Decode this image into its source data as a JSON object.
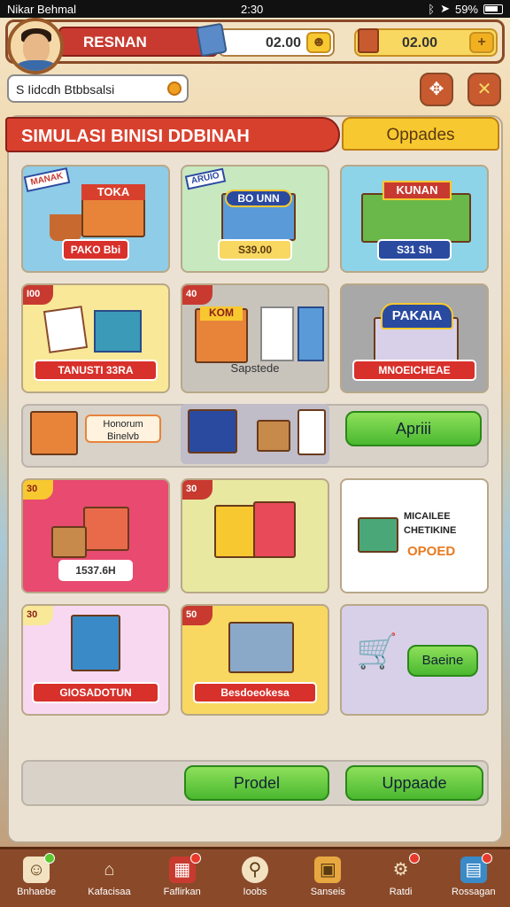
{
  "status_bar": {
    "carrier": "Nikar Behmal",
    "time": "2:30",
    "battery": "59%"
  },
  "header": {
    "player_name": "RESNAN",
    "coins": "02.00",
    "gems": "02.00"
  },
  "search": {
    "value": "S Iidcdh Btbbsalsi"
  },
  "main": {
    "title": "SIMULASI BINISI DDBINAH",
    "tab_upgrades": "Oppades"
  },
  "cards": {
    "toko": {
      "sign": "TOKA",
      "banner": "MANAK",
      "label": "PAKO Bbi"
    },
    "bioskop": {
      "sign": "BO UNN",
      "banner": "ARUIO",
      "label": "S39.00"
    },
    "kuliner": {
      "sign": "KUNAN",
      "label": "S31 Sh"
    },
    "books": {
      "badge": "I00",
      "label": "TANUSTI 33RA"
    },
    "kiosk": {
      "badge": "40",
      "sign": "KOM",
      "label": "Sapstede"
    },
    "pakaian": {
      "sign": "PAKAIA",
      "label": "MNOEICHEAE"
    },
    "market_row": {
      "text": "Honorum Binelvb",
      "button": "Apriii"
    },
    "market_shop": {
      "badge": "30",
      "label": "1537.6H"
    },
    "stall": {
      "badge": "30"
    },
    "promo": {
      "line1": "MICAILEE",
      "line2": "CHETIKINE",
      "line3": "OPOED"
    },
    "atm": {
      "badge": "30",
      "label": "GIOSADOTUN"
    },
    "fridge": {
      "badge": "50",
      "label": "Besdoeokesa"
    },
    "cart": {
      "button": "Baeine"
    }
  },
  "actions": {
    "produce": "Prodel",
    "upgrade": "Uppaade"
  },
  "nav": [
    {
      "label": "Bnhaebe",
      "icon": "mask-icon"
    },
    {
      "label": "Kafacisaa",
      "icon": "home-icon"
    },
    {
      "label": "Faflirkan",
      "icon": "shop-icon"
    },
    {
      "label": "Ioobs",
      "icon": "search-icon"
    },
    {
      "label": "Sanseis",
      "icon": "box-icon"
    },
    {
      "label": "Ratdi",
      "icon": "gear-icon"
    },
    {
      "label": "Rossagan",
      "icon": "map-icon"
    }
  ]
}
